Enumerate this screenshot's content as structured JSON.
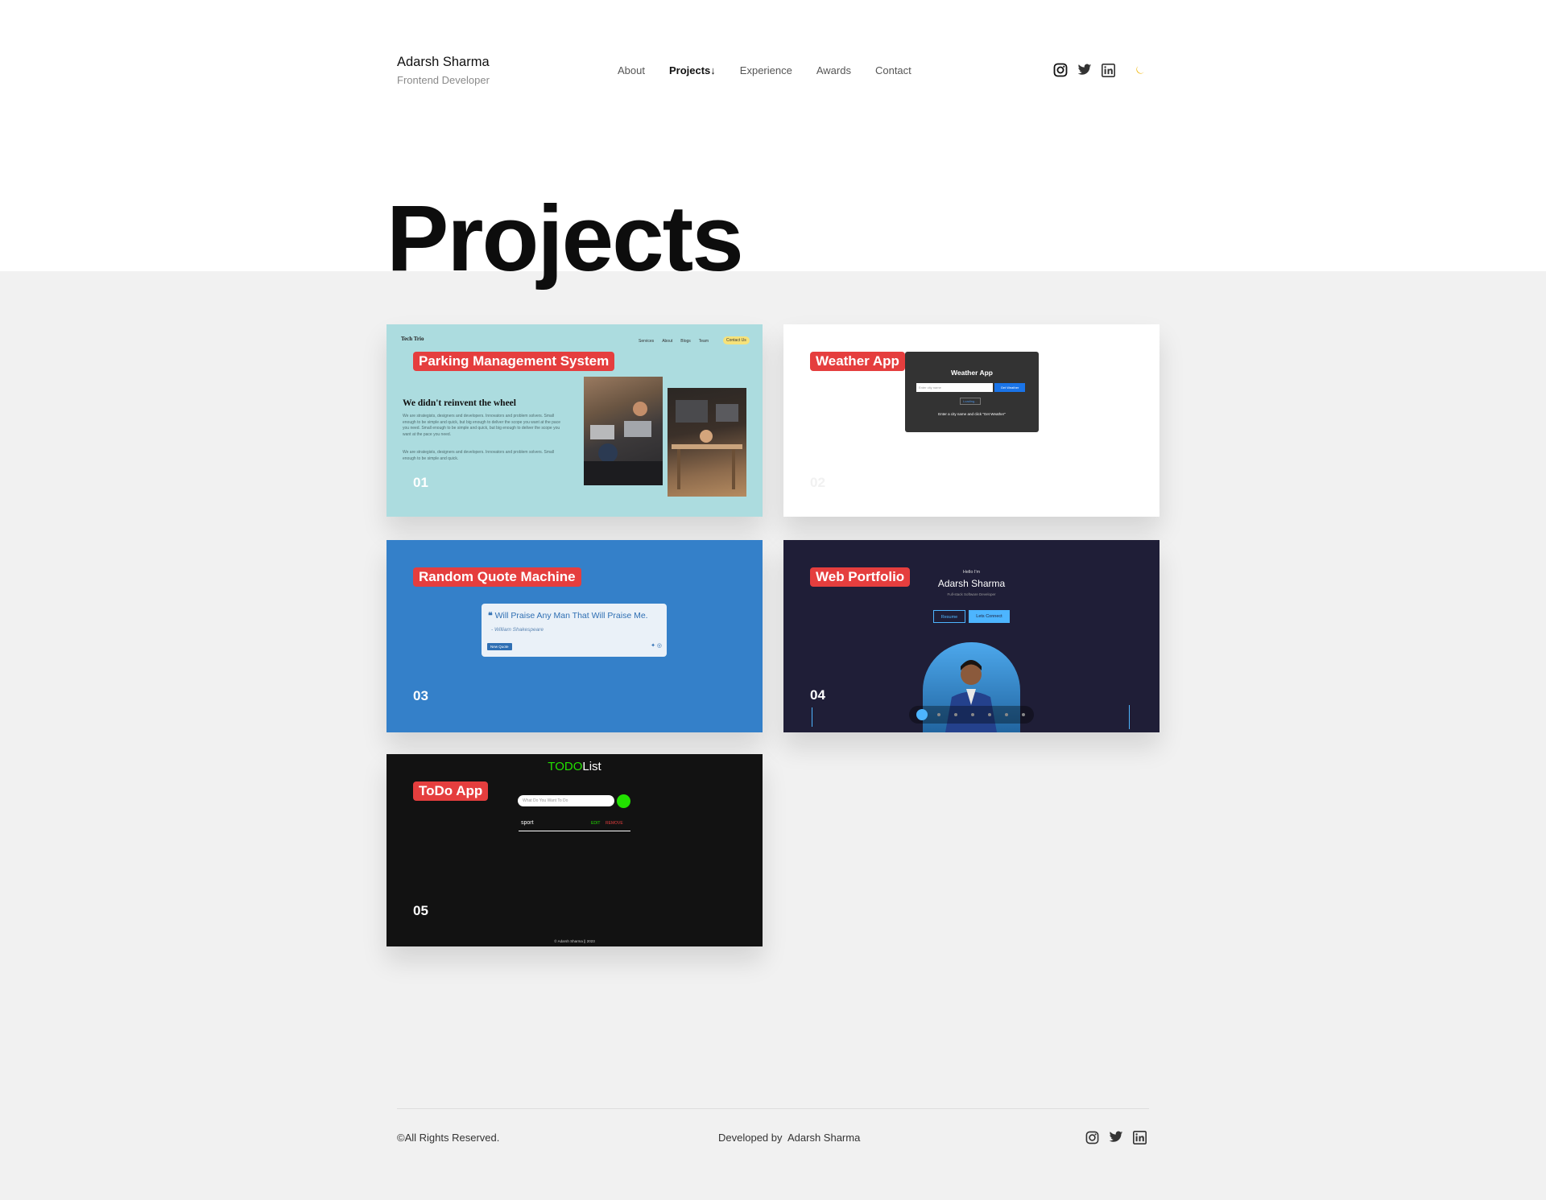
{
  "header": {
    "name": "Adarsh Sharma",
    "role": "Frontend Developer",
    "nav": [
      "About",
      "Projects↓",
      "Experience",
      "Awards",
      "Contact"
    ],
    "social_icons": [
      "instagram-icon",
      "twitter-icon",
      "linkedin-icon",
      "moon-icon"
    ]
  },
  "page_title": "Projects",
  "projects": [
    {
      "title": "Parking Management System",
      "number": "01",
      "preview": {
        "logo": "Tech Trio",
        "nav": [
          "Services",
          "About",
          "Blogs",
          "Team"
        ],
        "cta": "Contact Us",
        "heading": "We didn't reinvent the wheel",
        "body1": "We are strategists, designers and developers. Innovators and problem solvers. Small enough to be simple and quick, but big enough to deliver the scope you want at the pace you need. Small enough to be simple and quick, but big enough to deliver the scope you want at the pace you need.",
        "body2": "We are strategists, designers and developers. Innovators and problem solvers. Small enough to be simple and quick."
      }
    },
    {
      "title": "Weather App",
      "number": "02",
      "preview": {
        "heading": "Weather App",
        "placeholder": "Enter city name",
        "button": "Get Weather",
        "hint": "Enter a city name and click \"Get Weather\"",
        "loading": "Loading..."
      }
    },
    {
      "title": "Random Quote Machine",
      "number": "03",
      "preview": {
        "quote": "Will Praise Any Man That Will Praise Me.",
        "author": "- William Shakespeare",
        "button": "New Quote"
      }
    },
    {
      "title": "Web Portfolio",
      "number": "04",
      "preview": {
        "hello": "Hello I'm",
        "name": "Adarsh Sharma",
        "role": "Full-stack Software Developer",
        "button1": "Resume",
        "button2": "Lets Connect"
      }
    },
    {
      "title": "ToDo App",
      "number": "05",
      "preview": {
        "title_green": "TODO",
        "title_white": "List",
        "placeholder": "What Do You Want To Do",
        "item": "sport",
        "edit": "EDIT",
        "remove": "REMOVE",
        "footer": "© Adarsh Sharma || 2023"
      }
    }
  ],
  "footer": {
    "copyright": "©All Rights Reserved.",
    "developed_by": "Developed by  Adarsh Sharma",
    "social_icons": [
      "instagram-icon",
      "twitter-icon",
      "linkedin-icon"
    ]
  },
  "colors": {
    "tag_red": "#e53e3e",
    "card1_bg": "#acdcdf",
    "card3_bg": "#3480c9",
    "card4_bg": "#1f1e37",
    "card5_bg": "#121212",
    "page_bg": "#f1f1f1",
    "moon": "#f0b400",
    "todo_green": "#22e000"
  }
}
